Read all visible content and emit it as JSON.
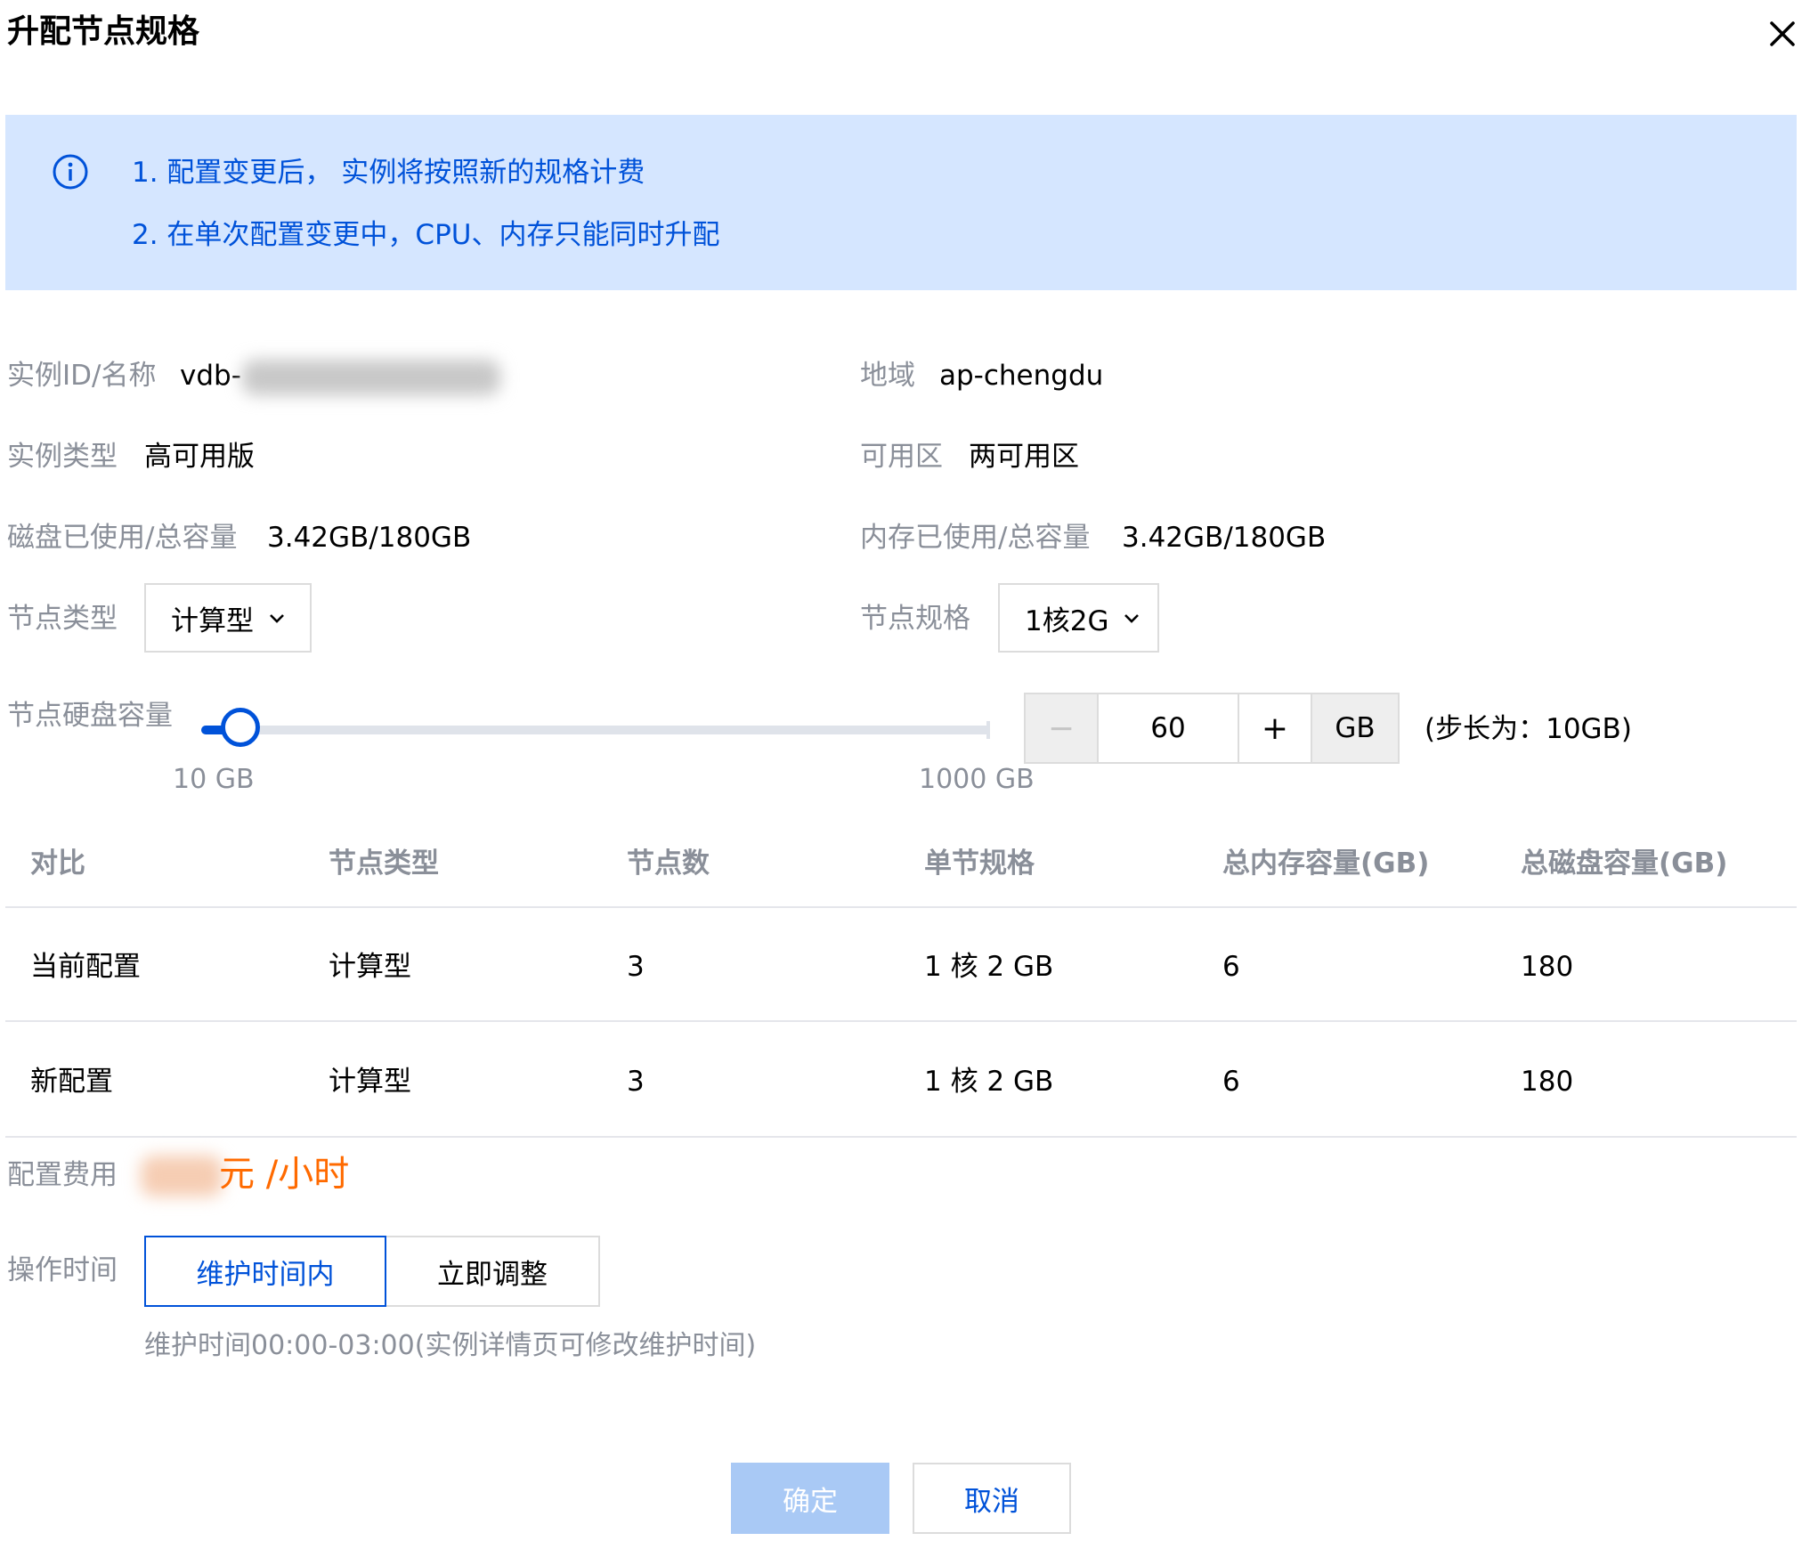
{
  "dialog": {
    "title": "升配节点规格"
  },
  "notice": {
    "lines": [
      "1. 配置变更后， 实例将按照新的规格计费",
      "2. 在单次配置变更中，CPU、内存只能同时升配"
    ]
  },
  "info": {
    "instance_id_label": "实例ID/名称",
    "instance_id_value": "vdb-",
    "region_label": "地域",
    "region_value": "ap-chengdu",
    "instance_type_label": "实例类型",
    "instance_type_value": "高可用版",
    "zone_label": "可用区",
    "zone_value": "两可用区",
    "disk_usage_label": "磁盘已使用/总容量",
    "disk_usage_value": "3.42GB/180GB",
    "mem_usage_label": "内存已使用/总容量",
    "mem_usage_value": "3.42GB/180GB"
  },
  "node_type": {
    "label": "节点类型",
    "selected": "计算型"
  },
  "node_spec": {
    "label": "节点规格",
    "selected": "1核2G"
  },
  "disk": {
    "label": "节点硬盘容量",
    "slider_min_label": "10 GB",
    "slider_max_label": "1000 GB",
    "slider_fraction": 0.05,
    "value": "60",
    "minus": "−",
    "plus": "+",
    "unit": "GB",
    "step_note": "(步长为：10GB)"
  },
  "compare_table": {
    "headers": [
      "对比",
      "节点类型",
      "节点数",
      "单节规格",
      "总内存容量(GB)",
      "总磁盘容量(GB)"
    ],
    "rows": [
      [
        "当前配置",
        "计算型",
        "3",
        "1 核 2 GB",
        "6",
        "180"
      ],
      [
        "新配置",
        "计算型",
        "3",
        "1 核 2 GB",
        "6",
        "180"
      ]
    ]
  },
  "cost": {
    "label": "配置费用",
    "unit": "元 /小时"
  },
  "operation": {
    "label": "操作时间",
    "options": [
      "维护时间内",
      "立即调整"
    ],
    "selected_index": 0,
    "hint": "维护时间00:00-03:00(实例详情页可修改维护时间)"
  },
  "footer": {
    "confirm": "确定",
    "cancel": "取消"
  },
  "colors": {
    "accent": "#0052d9",
    "notice_bg": "#d5e6ff",
    "cost": "#ff6a00",
    "label": "#8a8f99"
  }
}
